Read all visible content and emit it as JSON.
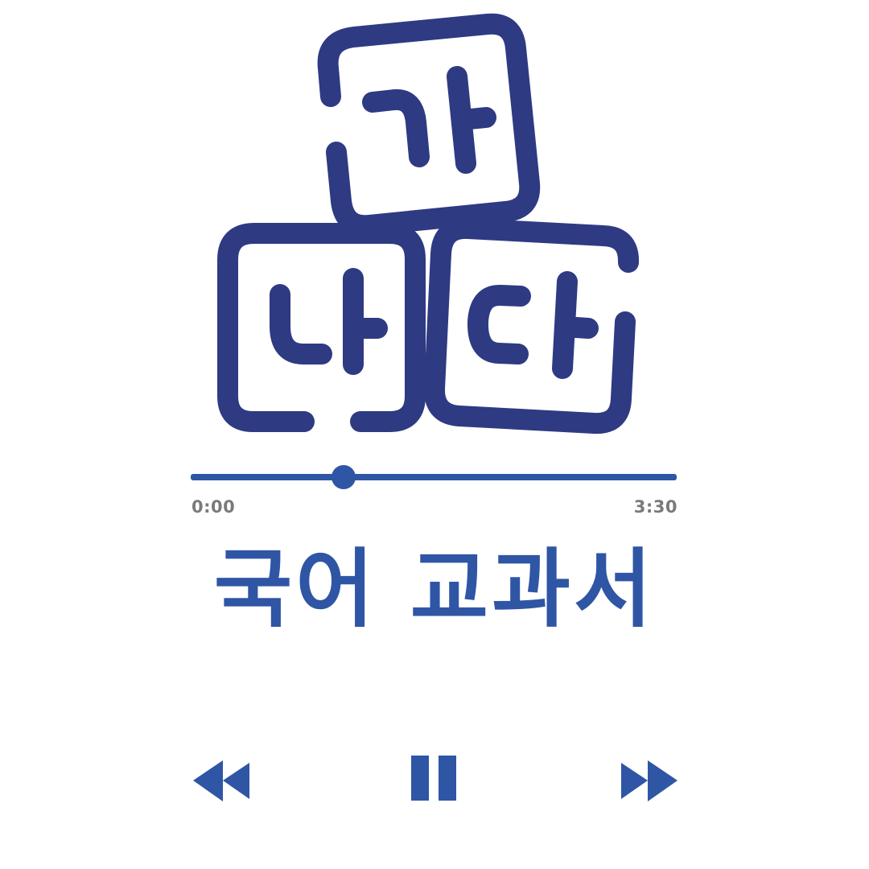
{
  "colors": {
    "accent": "#2f55a5",
    "artwork_stroke": "#2e3a82",
    "time_text": "#7a7a7a",
    "background": "#ffffff"
  },
  "artwork": {
    "icon": "hangul-blocks-icon",
    "blocks": [
      "가",
      "나",
      "다"
    ]
  },
  "player": {
    "progress": 0.315,
    "current_time": "0:00",
    "total_time": "3:30"
  },
  "track": {
    "title": "국어 교과서"
  },
  "controls": {
    "rewind_icon": "rewind-icon",
    "pause_icon": "pause-icon",
    "fast_forward_icon": "fast-forward-icon"
  }
}
